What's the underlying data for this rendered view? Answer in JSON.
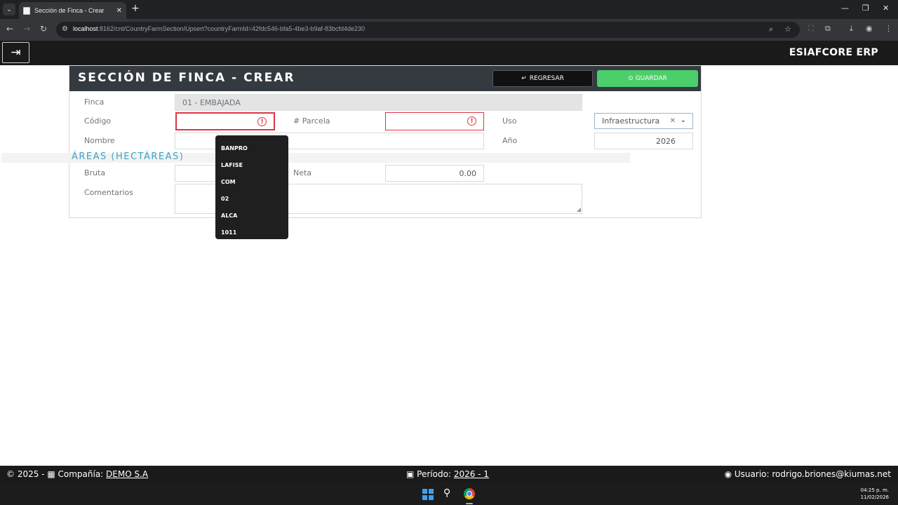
{
  "browser": {
    "tab_title": "Sección de Finca - Crear",
    "url_host": "localhost",
    "url_rest": ":8162/cnt/CountryFarmSection/Upsert?countryFarmId=42fdc546-bfa5-4be3-b9af-83bcfd4de230"
  },
  "app": {
    "brand": "ESIAFCORE ERP"
  },
  "form": {
    "title": "SECCIÓN DE FINCA - CREAR",
    "back_label": "REGRESAR",
    "save_label": "GUARDAR",
    "finca_label": "Finca",
    "finca_value": "01 - EMBAJADA",
    "codigo_label": "Código",
    "codigo_value": "",
    "parcela_label": "# Parcela",
    "parcela_value": "",
    "uso_label": "Uso",
    "uso_value": "Infraestructura",
    "nombre_label": "Nombre",
    "nombre_value": "",
    "anio_label": "Año",
    "anio_value": "2026",
    "areas_title": "ÁREAS (HECTÁREAS)",
    "bruta_label": "Bruta",
    "bruta_value": "",
    "neta_label": "Neta",
    "neta_value": "0.00",
    "comentarios_label": "Comentarios",
    "comentarios_value": ""
  },
  "autocomplete": {
    "items": [
      "BANPRO",
      "LAFISE",
      "COM",
      "02",
      "ALCA",
      "1011"
    ]
  },
  "footer": {
    "copyright": "© 2025 -",
    "company_label": "Compañía:",
    "company_value": "DEMO S.A",
    "period_label": "Período:",
    "period_value": "2026 - 1",
    "user_label": "Usuario:",
    "user_value": "rodrigo.briones@kiumas.net"
  },
  "taskbar": {
    "time": "04:25 p. m.",
    "date": "11/02/2026"
  },
  "colors": {
    "save_button": "#4cce6b",
    "error": "#dc3545",
    "section_title": "#3ea2c7",
    "header": "#343a40"
  }
}
